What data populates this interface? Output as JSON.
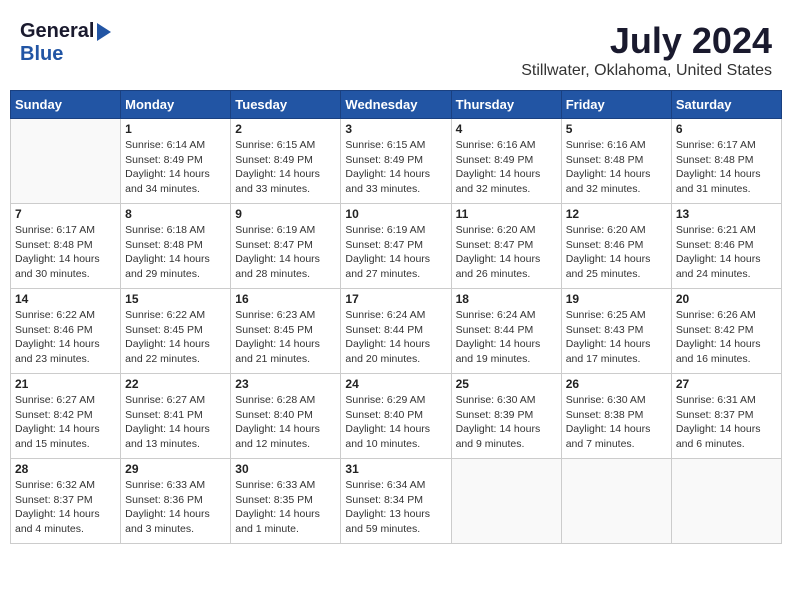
{
  "header": {
    "logo_general": "General",
    "logo_blue": "Blue",
    "month_year": "July 2024",
    "location": "Stillwater, Oklahoma, United States"
  },
  "calendar": {
    "days_of_week": [
      "Sunday",
      "Monday",
      "Tuesday",
      "Wednesday",
      "Thursday",
      "Friday",
      "Saturday"
    ],
    "weeks": [
      [
        {
          "day": "",
          "info": ""
        },
        {
          "day": "1",
          "info": "Sunrise: 6:14 AM\nSunset: 8:49 PM\nDaylight: 14 hours\nand 34 minutes."
        },
        {
          "day": "2",
          "info": "Sunrise: 6:15 AM\nSunset: 8:49 PM\nDaylight: 14 hours\nand 33 minutes."
        },
        {
          "day": "3",
          "info": "Sunrise: 6:15 AM\nSunset: 8:49 PM\nDaylight: 14 hours\nand 33 minutes."
        },
        {
          "day": "4",
          "info": "Sunrise: 6:16 AM\nSunset: 8:49 PM\nDaylight: 14 hours\nand 32 minutes."
        },
        {
          "day": "5",
          "info": "Sunrise: 6:16 AM\nSunset: 8:48 PM\nDaylight: 14 hours\nand 32 minutes."
        },
        {
          "day": "6",
          "info": "Sunrise: 6:17 AM\nSunset: 8:48 PM\nDaylight: 14 hours\nand 31 minutes."
        }
      ],
      [
        {
          "day": "7",
          "info": "Sunrise: 6:17 AM\nSunset: 8:48 PM\nDaylight: 14 hours\nand 30 minutes."
        },
        {
          "day": "8",
          "info": "Sunrise: 6:18 AM\nSunset: 8:48 PM\nDaylight: 14 hours\nand 29 minutes."
        },
        {
          "day": "9",
          "info": "Sunrise: 6:19 AM\nSunset: 8:47 PM\nDaylight: 14 hours\nand 28 minutes."
        },
        {
          "day": "10",
          "info": "Sunrise: 6:19 AM\nSunset: 8:47 PM\nDaylight: 14 hours\nand 27 minutes."
        },
        {
          "day": "11",
          "info": "Sunrise: 6:20 AM\nSunset: 8:47 PM\nDaylight: 14 hours\nand 26 minutes."
        },
        {
          "day": "12",
          "info": "Sunrise: 6:20 AM\nSunset: 8:46 PM\nDaylight: 14 hours\nand 25 minutes."
        },
        {
          "day": "13",
          "info": "Sunrise: 6:21 AM\nSunset: 8:46 PM\nDaylight: 14 hours\nand 24 minutes."
        }
      ],
      [
        {
          "day": "14",
          "info": "Sunrise: 6:22 AM\nSunset: 8:46 PM\nDaylight: 14 hours\nand 23 minutes."
        },
        {
          "day": "15",
          "info": "Sunrise: 6:22 AM\nSunset: 8:45 PM\nDaylight: 14 hours\nand 22 minutes."
        },
        {
          "day": "16",
          "info": "Sunrise: 6:23 AM\nSunset: 8:45 PM\nDaylight: 14 hours\nand 21 minutes."
        },
        {
          "day": "17",
          "info": "Sunrise: 6:24 AM\nSunset: 8:44 PM\nDaylight: 14 hours\nand 20 minutes."
        },
        {
          "day": "18",
          "info": "Sunrise: 6:24 AM\nSunset: 8:44 PM\nDaylight: 14 hours\nand 19 minutes."
        },
        {
          "day": "19",
          "info": "Sunrise: 6:25 AM\nSunset: 8:43 PM\nDaylight: 14 hours\nand 17 minutes."
        },
        {
          "day": "20",
          "info": "Sunrise: 6:26 AM\nSunset: 8:42 PM\nDaylight: 14 hours\nand 16 minutes."
        }
      ],
      [
        {
          "day": "21",
          "info": "Sunrise: 6:27 AM\nSunset: 8:42 PM\nDaylight: 14 hours\nand 15 minutes."
        },
        {
          "day": "22",
          "info": "Sunrise: 6:27 AM\nSunset: 8:41 PM\nDaylight: 14 hours\nand 13 minutes."
        },
        {
          "day": "23",
          "info": "Sunrise: 6:28 AM\nSunset: 8:40 PM\nDaylight: 14 hours\nand 12 minutes."
        },
        {
          "day": "24",
          "info": "Sunrise: 6:29 AM\nSunset: 8:40 PM\nDaylight: 14 hours\nand 10 minutes."
        },
        {
          "day": "25",
          "info": "Sunrise: 6:30 AM\nSunset: 8:39 PM\nDaylight: 14 hours\nand 9 minutes."
        },
        {
          "day": "26",
          "info": "Sunrise: 6:30 AM\nSunset: 8:38 PM\nDaylight: 14 hours\nand 7 minutes."
        },
        {
          "day": "27",
          "info": "Sunrise: 6:31 AM\nSunset: 8:37 PM\nDaylight: 14 hours\nand 6 minutes."
        }
      ],
      [
        {
          "day": "28",
          "info": "Sunrise: 6:32 AM\nSunset: 8:37 PM\nDaylight: 14 hours\nand 4 minutes."
        },
        {
          "day": "29",
          "info": "Sunrise: 6:33 AM\nSunset: 8:36 PM\nDaylight: 14 hours\nand 3 minutes."
        },
        {
          "day": "30",
          "info": "Sunrise: 6:33 AM\nSunset: 8:35 PM\nDaylight: 14 hours\nand 1 minute."
        },
        {
          "day": "31",
          "info": "Sunrise: 6:34 AM\nSunset: 8:34 PM\nDaylight: 13 hours\nand 59 minutes."
        },
        {
          "day": "",
          "info": ""
        },
        {
          "day": "",
          "info": ""
        },
        {
          "day": "",
          "info": ""
        }
      ]
    ]
  }
}
